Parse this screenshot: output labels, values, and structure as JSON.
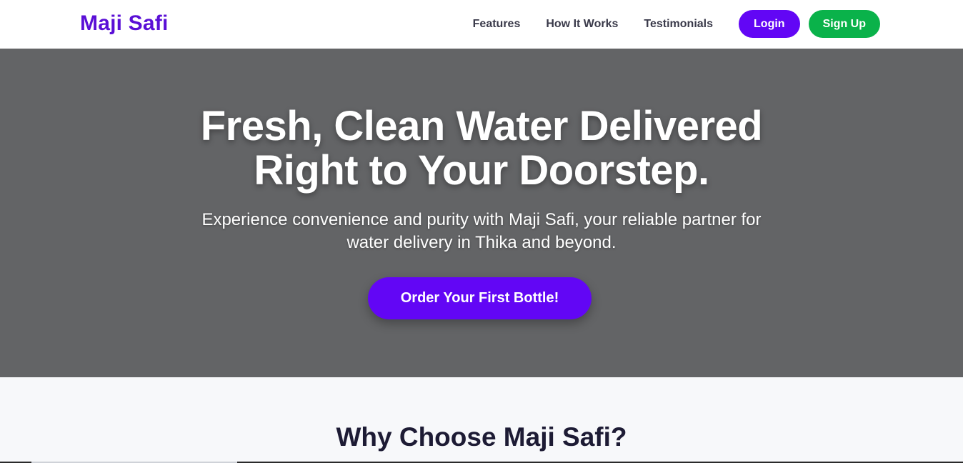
{
  "header": {
    "brand": "Maji Safi",
    "nav": [
      "Features",
      "How It Works",
      "Testimonials"
    ],
    "login_label": "Login",
    "signup_label": "Sign Up"
  },
  "hero": {
    "title_line1": "Fresh, Clean Water Delivered",
    "title_line2": "Right to Your Doorstep.",
    "subtitle_line1": "Experience convenience and purity with Maji Safi, your reliable partner for",
    "subtitle_line2": "water delivery in Thika and beyond.",
    "cta_label": "Order Your First Bottle!"
  },
  "features": {
    "title": "Why Choose Maji Safi?"
  },
  "colors": {
    "brand_purple": "#5a0fd6",
    "button_purple": "#6206f5",
    "button_green": "#0ab24a",
    "hero_bg": "#636466",
    "section_bg": "#f7f8fa"
  }
}
